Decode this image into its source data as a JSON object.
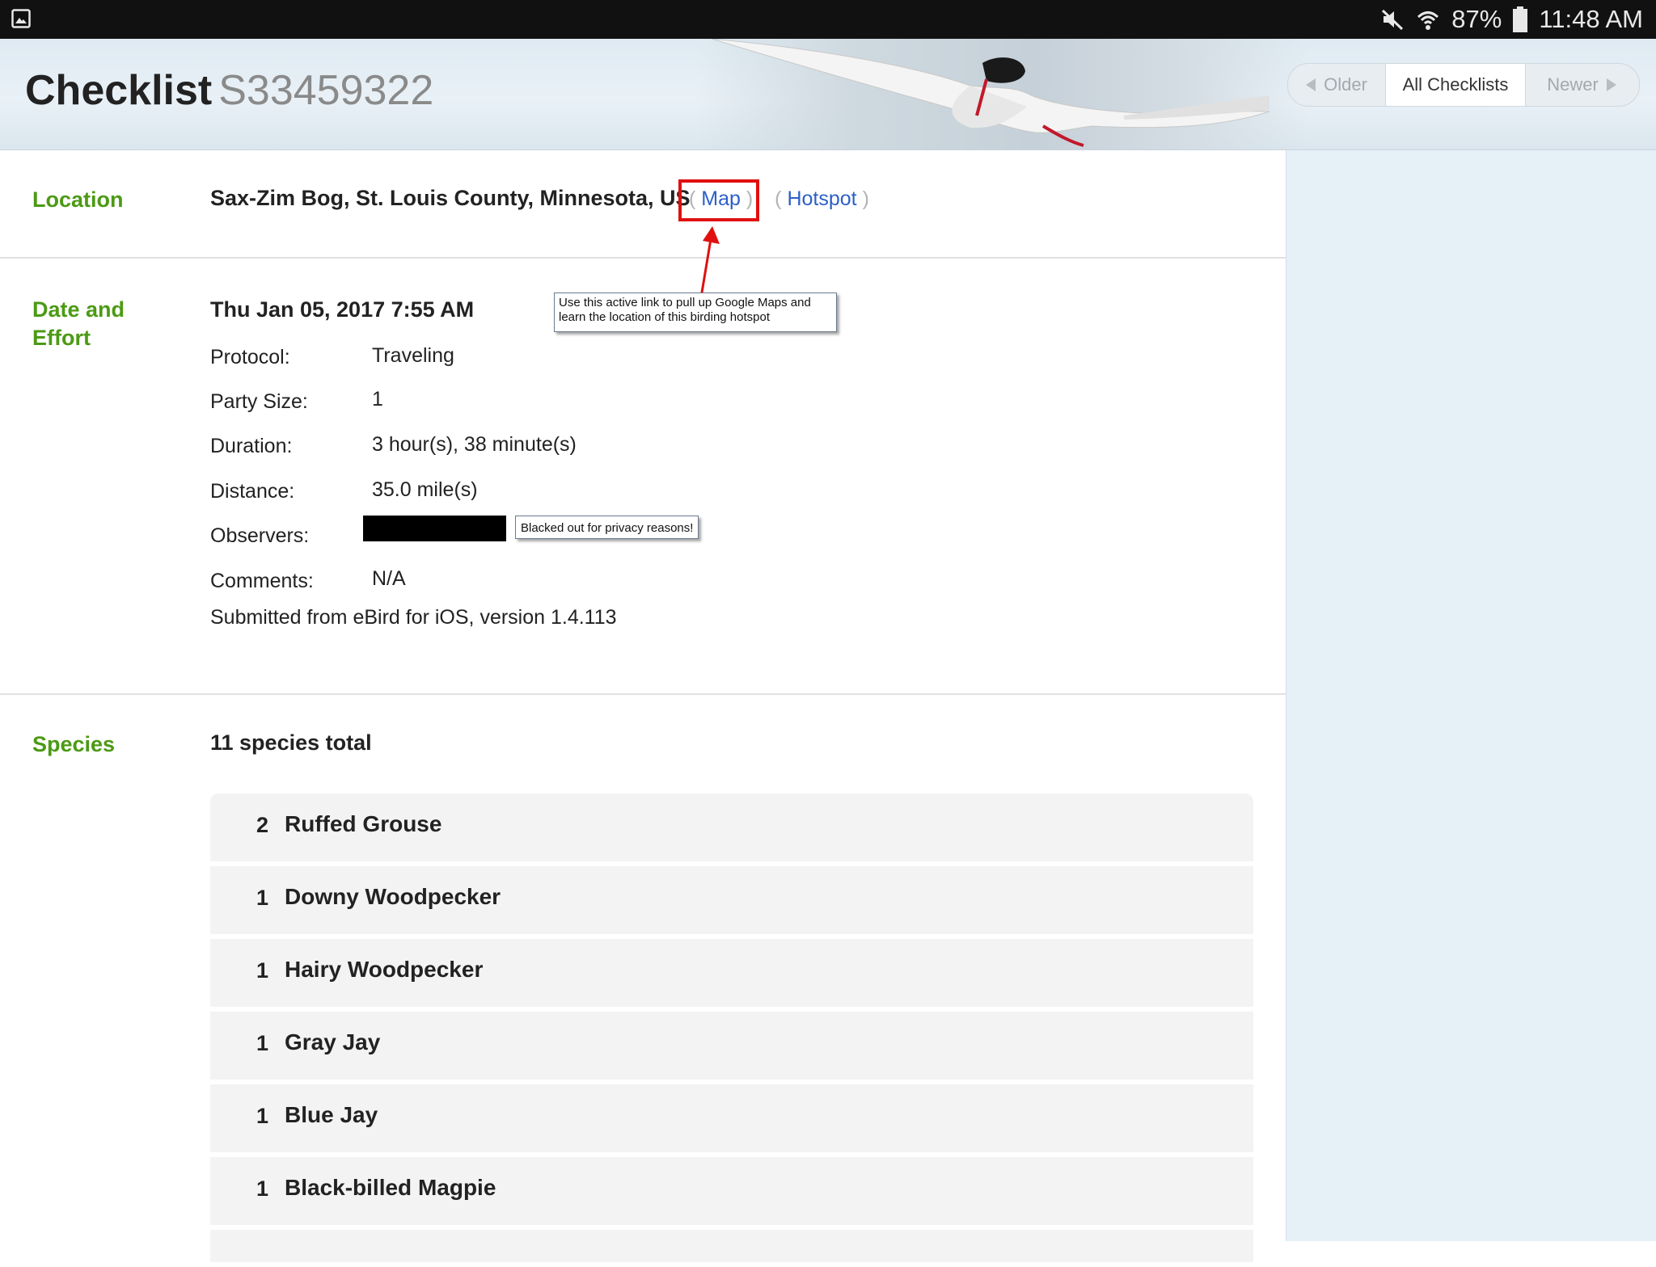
{
  "status_bar": {
    "battery": "87%",
    "time": "11:48 AM",
    "icons": [
      "gallery-icon",
      "mute-icon",
      "wifi-icon",
      "battery-icon"
    ]
  },
  "header": {
    "title": "Checklist",
    "checklist_id": "S33459322",
    "pager": {
      "older": "Older",
      "all": "All Checklists",
      "newer": "Newer"
    }
  },
  "location": {
    "label": "Location",
    "value": "Sax-Zim Bog, St. Louis County, Minnesota, US",
    "map_link": "Map",
    "hotspot_link": "Hotspot",
    "annotation": "Use this active link to pull up Google Maps and learn the location of this birding hotspot"
  },
  "date_effort": {
    "label_line1": "Date and",
    "label_line2": "Effort",
    "datetime": "Thu Jan 05, 2017 7:55 AM",
    "fields": [
      {
        "label": "Protocol:",
        "value": "Traveling"
      },
      {
        "label": "Party Size:",
        "value": "1"
      },
      {
        "label": "Duration:",
        "value": "3 hour(s), 38 minute(s)"
      },
      {
        "label": "Distance:",
        "value": "35.0 mile(s)"
      },
      {
        "label": "Observers:",
        "value": ""
      },
      {
        "label": "Comments:",
        "value": "N/A"
      }
    ],
    "privacy_note": "Blacked out for privacy reasons!",
    "submitted": "Submitted from eBird for iOS, version 1.4.113"
  },
  "species": {
    "label": "Species",
    "total": "11 species total",
    "items": [
      {
        "count": "2",
        "name": "Ruffed Grouse"
      },
      {
        "count": "1",
        "name": "Downy Woodpecker"
      },
      {
        "count": "1",
        "name": "Hairy Woodpecker"
      },
      {
        "count": "1",
        "name": "Gray Jay"
      },
      {
        "count": "1",
        "name": "Blue Jay"
      },
      {
        "count": "1",
        "name": "Black-billed Magpie"
      }
    ]
  },
  "colors": {
    "section_label": "#4c9a14",
    "link": "#2c5fc7",
    "highlight": "#e01010",
    "sidebar": "#e6f0f7"
  }
}
